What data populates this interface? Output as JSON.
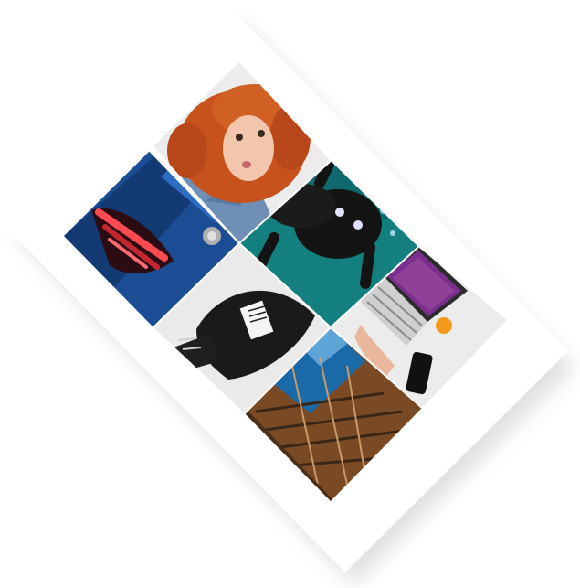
{
  "mockup": {
    "photos": [
      {
        "subject": "red-haired-woman-portrait"
      },
      {
        "subject": "blue-car-taillight"
      },
      {
        "subject": "dog-swimming-underwater"
      },
      {
        "subject": "black-sweatshirt-with-printed-label"
      },
      {
        "subject": "laptop-and-phone-on-desk"
      },
      {
        "subject": "fire-escape-stairs-from-below"
      }
    ],
    "colors": {
      "paper": "#ffffff",
      "shadow": "#c8c8c8",
      "hair": "#c8521c",
      "skin": "#f1c6ad",
      "denim": "#6f8fb7",
      "car_blue": "#1b4d95",
      "taillight": "#c3262e",
      "water": "#13807f",
      "dog": "#141414",
      "sweatshirt": "#1a1a1a",
      "laptop_screen": "#7a2f8f",
      "orange": "#f39a1c",
      "sky": "#1a6aa8",
      "stairs_brown": "#7a4a24"
    }
  }
}
